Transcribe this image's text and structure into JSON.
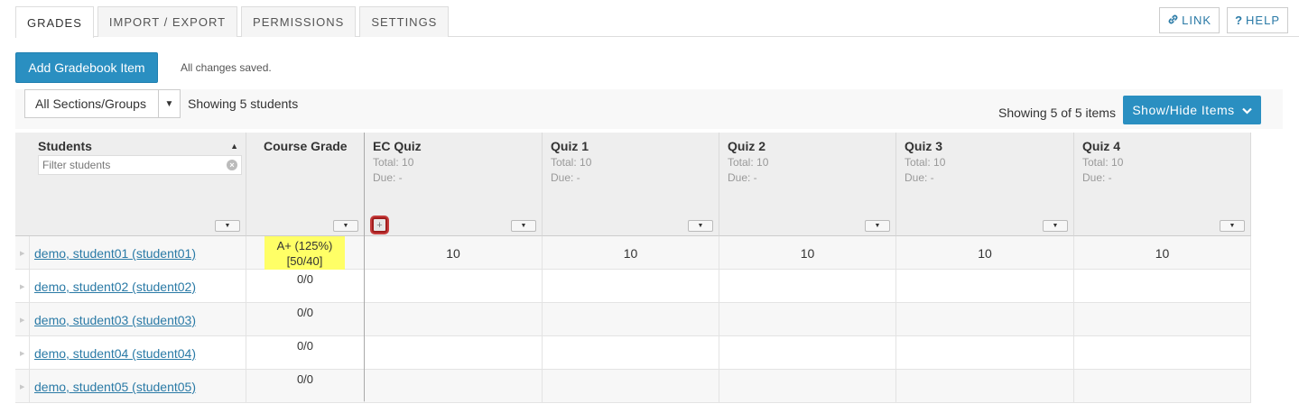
{
  "tabs": [
    {
      "label": "GRADES",
      "active": true
    },
    {
      "label": "IMPORT / EXPORT",
      "active": false
    },
    {
      "label": "PERMISSIONS",
      "active": false
    },
    {
      "label": "SETTINGS",
      "active": false
    }
  ],
  "top_buttons": {
    "link": {
      "icon": "link-icon",
      "label": "LINK"
    },
    "help": {
      "icon": "question-icon",
      "label": "HELP"
    }
  },
  "toolbar": {
    "add_item_label": "Add Gradebook Item",
    "save_status": "All changes saved."
  },
  "filters": {
    "section_select": "All Sections/Groups",
    "showing_students": "Showing 5 students",
    "showing_items": "Showing 5 of 5 items",
    "show_hide_label": "Show/Hide Items"
  },
  "grid": {
    "students_header": "Students",
    "filter_placeholder": "Filter students",
    "course_grade_header": "Course Grade",
    "items": [
      {
        "title": "EC Quiz",
        "total": "Total: 10",
        "due": "Due: -"
      },
      {
        "title": "Quiz 1",
        "total": "Total: 10",
        "due": "Due: -"
      },
      {
        "title": "Quiz 2",
        "total": "Total: 10",
        "due": "Due: -"
      },
      {
        "title": "Quiz 3",
        "total": "Total: 10",
        "due": "Due: -"
      },
      {
        "title": "Quiz 4",
        "total": "Total: 10",
        "due": "Due: -"
      }
    ],
    "rows": [
      {
        "student": "demo, student01 (student01)",
        "grade_line1": "A+ (125%)",
        "grade_line2": "[50/40]",
        "highlight": true,
        "scores": [
          "10",
          "10",
          "10",
          "10",
          "10"
        ]
      },
      {
        "student": "demo, student02 (student02)",
        "grade_line1": "0/0",
        "grade_line2": "",
        "highlight": false,
        "scores": [
          "",
          "",
          "",
          "",
          ""
        ]
      },
      {
        "student": "demo, student03 (student03)",
        "grade_line1": "0/0",
        "grade_line2": "",
        "highlight": false,
        "scores": [
          "",
          "",
          "",
          "",
          ""
        ]
      },
      {
        "student": "demo, student04 (student04)",
        "grade_line1": "0/0",
        "grade_line2": "",
        "highlight": false,
        "scores": [
          "",
          "",
          "",
          "",
          ""
        ]
      },
      {
        "student": "demo, student05 (student05)",
        "grade_line1": "0/0",
        "grade_line2": "",
        "highlight": false,
        "scores": [
          "",
          "",
          "",
          "",
          ""
        ]
      }
    ]
  },
  "colors": {
    "primary": "#2a8fc1",
    "link": "#2a7aa6",
    "highlight": "#ffff66",
    "focus_ring": "#a01c1c"
  }
}
